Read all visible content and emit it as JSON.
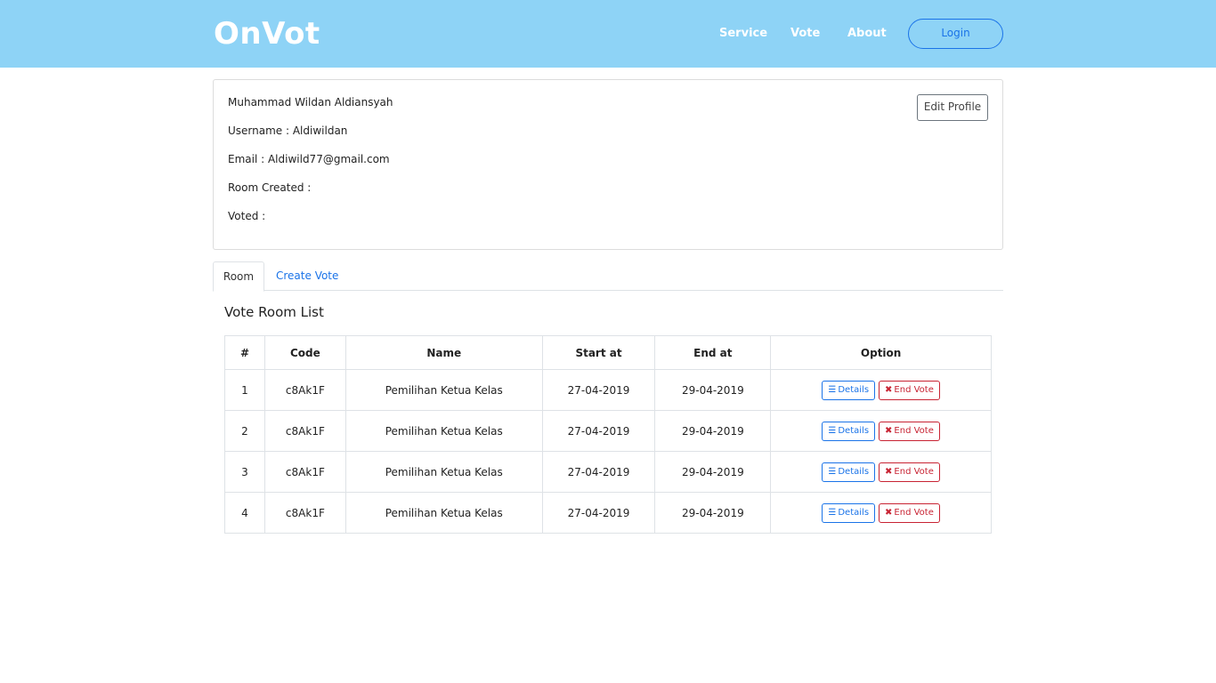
{
  "navbar": {
    "brand": "OnVot",
    "links": [
      "Service",
      "Vote",
      "About"
    ],
    "login_label": "Login"
  },
  "profile": {
    "name": "Muhammad Wildan Aldiansyah",
    "username_line": "Username : Aldiwildan",
    "email_line": "Email : Aldiwild77@gmail.com",
    "room_created_line": "Room Created :",
    "voted_line": "Voted :",
    "edit_label": "Edit Profile"
  },
  "tabs": {
    "room": "Room",
    "create_vote": "Create Vote"
  },
  "section_title": "Vote Room List",
  "table": {
    "headers": [
      "#",
      "Code",
      "Name",
      "Start at",
      "End at",
      "Option"
    ],
    "details_label": "Details",
    "end_label": "End Vote",
    "details_icon": "list-icon",
    "end_icon": "times-icon",
    "rows": [
      {
        "num": "1",
        "code": "c8Ak1F",
        "name": "Pemilihan Ketua Kelas",
        "start": "27-04-2019",
        "end": "29-04-2019"
      },
      {
        "num": "2",
        "code": "c8Ak1F",
        "name": "Pemilihan Ketua Kelas",
        "start": "27-04-2019",
        "end": "29-04-2019"
      },
      {
        "num": "3",
        "code": "c8Ak1F",
        "name": "Pemilihan Ketua Kelas",
        "start": "27-04-2019",
        "end": "29-04-2019"
      },
      {
        "num": "4",
        "code": "c8Ak1F",
        "name": "Pemilihan Ketua Kelas",
        "start": "27-04-2019",
        "end": "29-04-2019"
      }
    ]
  },
  "colors": {
    "navbar_bg": "#8ed3f6",
    "primary": "#1a73e8",
    "danger": "#c82333"
  }
}
